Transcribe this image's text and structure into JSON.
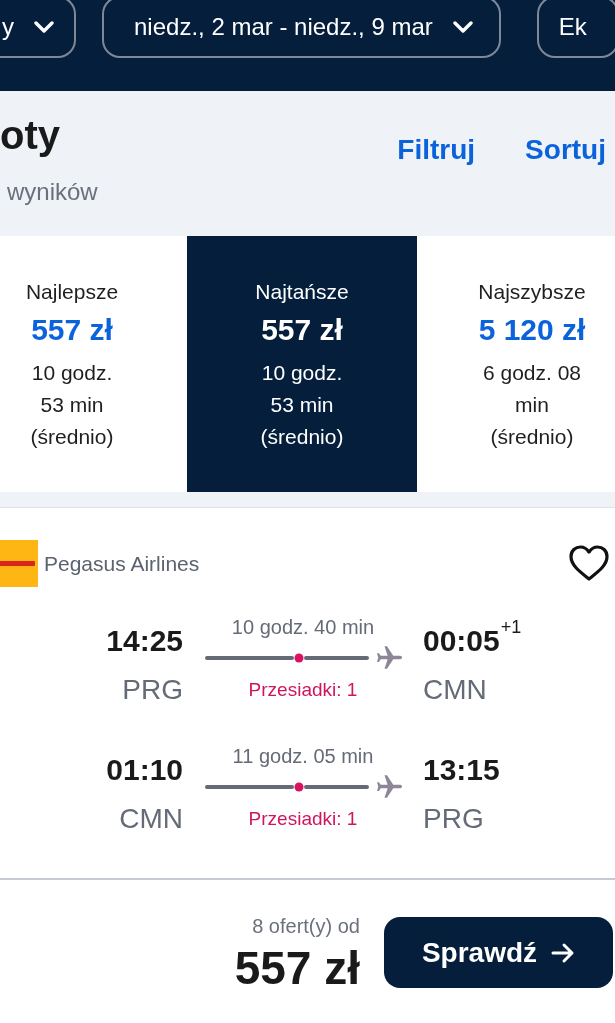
{
  "search_bar": {
    "filters": [
      {
        "label": "y",
        "chevron": true
      },
      {
        "label": "niedz., 2 mar - niedz., 9 mar",
        "chevron": true
      },
      {
        "label": "Ek",
        "chevron": false
      }
    ]
  },
  "header": {
    "title": "oty",
    "subtitle": "wyników",
    "actions": [
      "Filtruj",
      "Sortuj"
    ]
  },
  "sort_tabs": [
    {
      "label": "Najlepsze",
      "price": "557 zł",
      "duration": "10 godz. 53 min (średnio)",
      "selected": false
    },
    {
      "label": "Najtańsze",
      "price": "557 zł",
      "duration": "10 godz. 53 min (średnio)",
      "selected": true
    },
    {
      "label": "Najszybsze",
      "price": "5 120 zł",
      "duration": "6 godz. 08 min (średnio)",
      "selected": false
    }
  ],
  "flight_card": {
    "airline": "Pegasus Airlines",
    "saved": false,
    "legs": [
      {
        "departure_time": "14:25",
        "departure_airport": "PRG",
        "duration": "10 godz. 40 min",
        "stops": "Przesiadki: 1",
        "arrival_time": "00:05",
        "day_offset": "+1",
        "arrival_airport": "CMN"
      },
      {
        "departure_time": "01:10",
        "departure_airport": "CMN",
        "duration": "11 godz. 05 min",
        "stops": "Przesiadki: 1",
        "arrival_time": "13:15",
        "arrival_airport": "PRG"
      }
    ],
    "offers": "8 ofert(y) od",
    "price": "557 zł",
    "button": "Sprawdź"
  }
}
